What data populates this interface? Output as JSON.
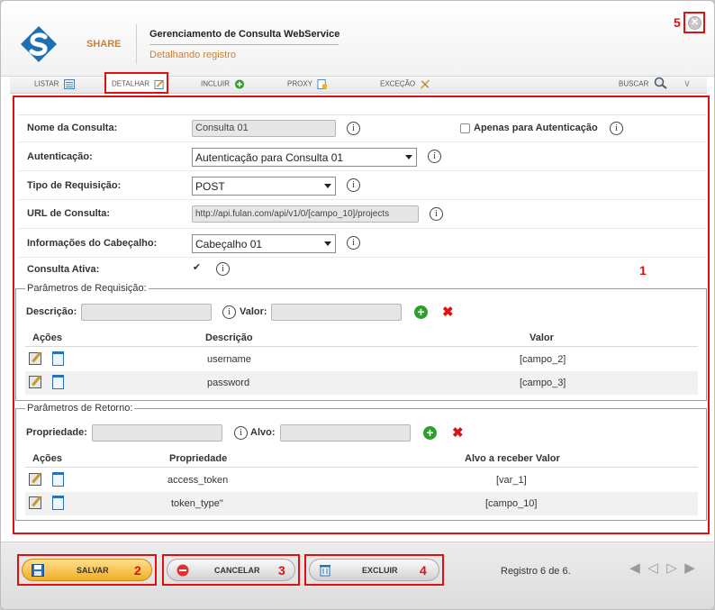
{
  "header": {
    "brand": "SHARE",
    "title": "Gerenciamento de Consulta WebService",
    "subtitle": "Detalhando registro",
    "close_label": "✕"
  },
  "badges": {
    "main": "1",
    "save": "2",
    "cancel": "3",
    "delete": "4",
    "close": "5"
  },
  "tabs": {
    "listar": "LISTAR",
    "detalhar": "DETALHAR",
    "incluir": "INCLUIR",
    "proxy": "PROXY",
    "excecao": "EXCEÇÃO",
    "buscar": "BUSCAR"
  },
  "form": {
    "nome_label": "Nome da Consulta:",
    "nome_value": "Consulta 01",
    "apenas_label": "Apenas para Autenticação",
    "autenticacao_label": "Autenticação:",
    "autenticacao_value": "Autenticação para Consulta 01",
    "tipo_label": "Tipo de Requisição:",
    "tipo_value": "POST",
    "url_label": "URL de Consulta:",
    "url_value": "http://api.fulan.com/api/v1/0/[campo_10]/projects",
    "cabecalho_label": "Informações do Cabeçalho:",
    "cabecalho_value": "Cabeçalho 01",
    "ativa_label": "Consulta Ativa:",
    "info_glyph": "i",
    "check_glyph": "✔"
  },
  "requisicao": {
    "legend": "Parâmetros de Requisição:",
    "descricao_label": "Descrição:",
    "valor_label": "Valor:",
    "columns": [
      "Ações",
      "Descrição",
      "Valor"
    ],
    "rows": [
      {
        "descricao": "username",
        "valor": "[campo_2]"
      },
      {
        "descricao": "password",
        "valor": "[campo_3]"
      }
    ]
  },
  "retorno": {
    "legend": "Parâmetros de Retorno:",
    "propriedade_label": "Propriedade:",
    "alvo_label": "Alvo:",
    "columns": [
      "Ações",
      "Propriedade",
      "Alvo a receber Valor"
    ],
    "rows": [
      {
        "propriedade": "access_token",
        "alvo": "[var_1]"
      },
      {
        "propriedade": "token_type\"",
        "alvo": "[campo_10]"
      }
    ]
  },
  "footer": {
    "salvar": "SALVAR",
    "cancelar": "CANCELAR",
    "excluir": "EXCLUIR",
    "registro": "Registro 6 de 6."
  },
  "colors": {
    "accent": "#e01010",
    "brand": "#c8823a",
    "add": "#2aa12a",
    "remove": "#d11111"
  }
}
